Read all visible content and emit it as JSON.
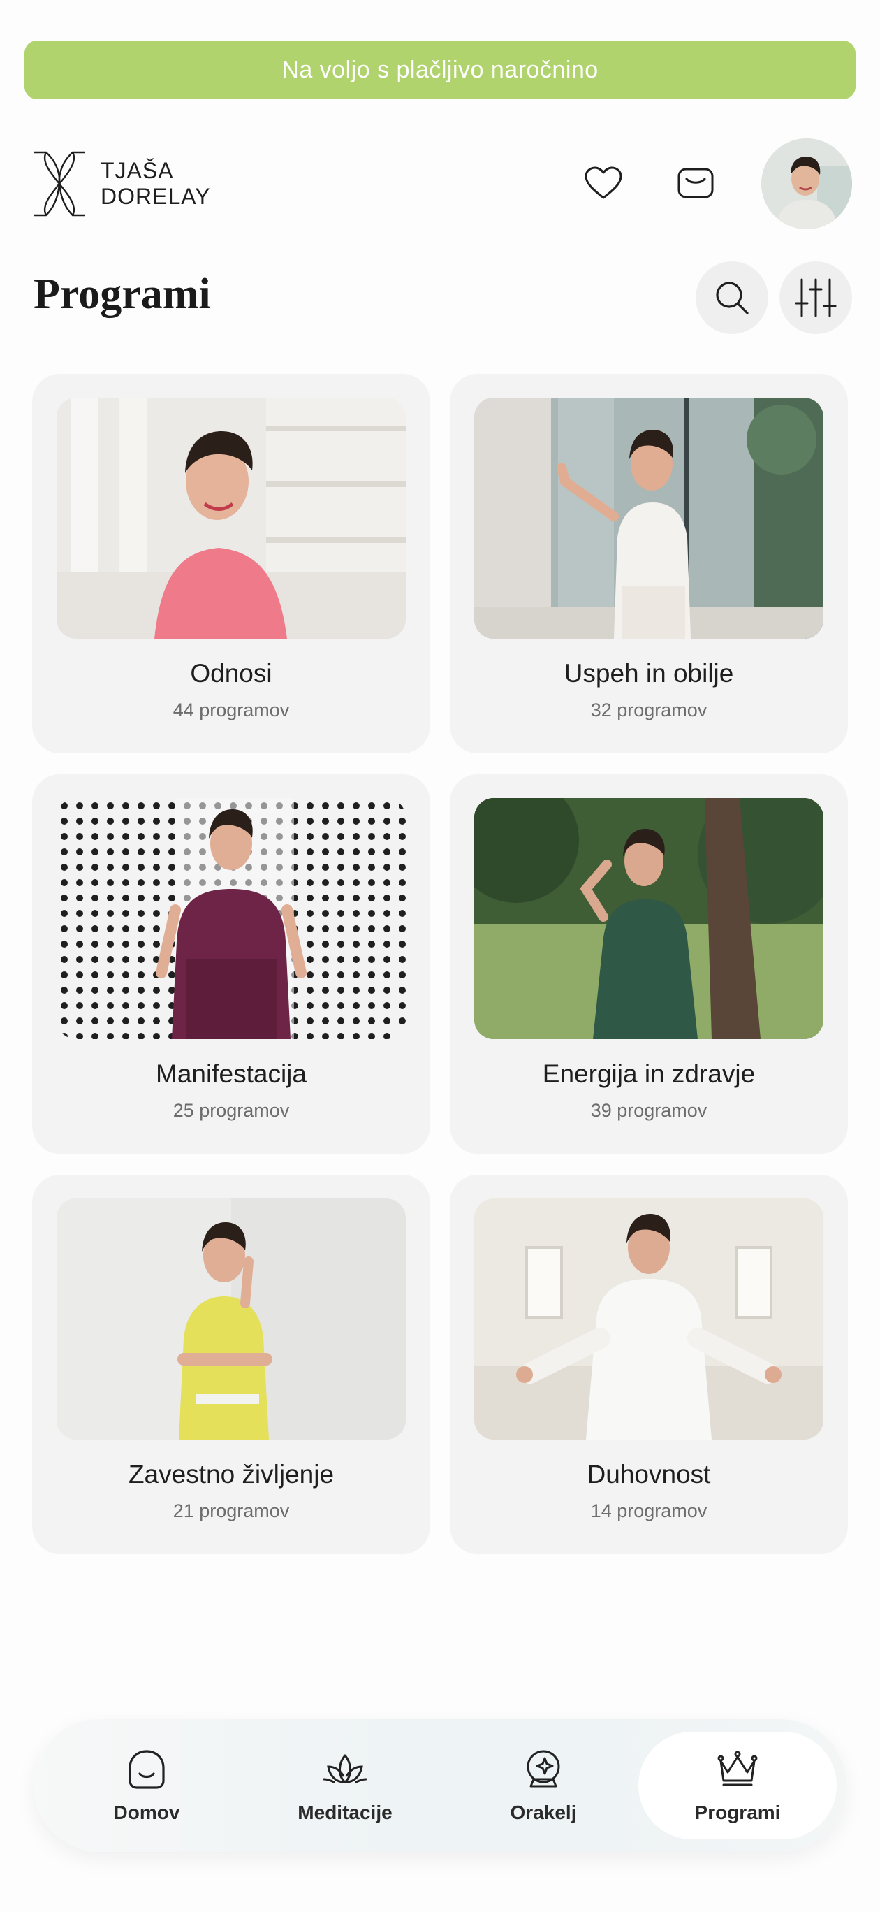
{
  "banner": {
    "text": "Na voljo s plačljivo naročnino"
  },
  "header": {
    "logo_line1": "TJAŠA",
    "logo_line2": "DORELAY",
    "icons": [
      "heart-icon",
      "inbox-icon"
    ]
  },
  "page": {
    "title": "Programi"
  },
  "toolbar": {
    "icons": [
      "search-icon",
      "filter-sliders-icon"
    ]
  },
  "categories": [
    {
      "title": "Odnosi",
      "count": "44 programov"
    },
    {
      "title": "Uspeh in obilje",
      "count": "32 programov"
    },
    {
      "title": "Manifestacija",
      "count": "25 programov"
    },
    {
      "title": "Energija in zdravje",
      "count": "39 programov"
    },
    {
      "title": "Zavestno življenje",
      "count": "21 programov"
    },
    {
      "title": "Duhovnost",
      "count": "14 programov"
    }
  ],
  "nav": {
    "items": [
      {
        "label": "Domov",
        "icon": "home-face-icon"
      },
      {
        "label": "Meditacije",
        "icon": "lotus-icon"
      },
      {
        "label": "Orakelj",
        "icon": "crystal-ball-icon"
      },
      {
        "label": "Programi",
        "icon": "crown-icon"
      }
    ],
    "active": "Programi"
  },
  "colors": {
    "banner": "#b1d36e",
    "card": "#f3f3f3",
    "nav_bg": "#eef3f5"
  }
}
